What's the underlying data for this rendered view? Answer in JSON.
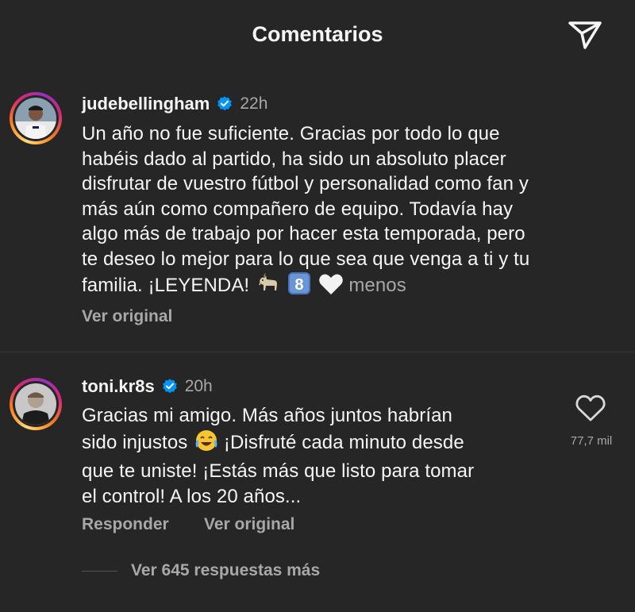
{
  "header": {
    "title": "Comentarios",
    "share_icon": "paper-plane-icon"
  },
  "comments": [
    {
      "username": "judebellingham",
      "verified": true,
      "time": "22h",
      "text": "Un año no fue suficiente. Gracias por todo lo que\nhabéis dado al partido, ha sido un absoluto placer\ndisfrutar de vuestro fútbol y personalidad como fan y\nmás aún como compañero de equipo. Todavía hay\nalgo más de trabajo por hacer esta temporada, pero\nte deseo lo mejor para lo que sea que venga a ti y tu\nfamilia. ¡LEYENDA! ",
      "emojis": [
        "goat-emoji",
        "keycap-8-emoji",
        "white-heart-emoji"
      ],
      "less_label": "menos",
      "see_translation": "Ver original"
    },
    {
      "username": "toni.kr8s",
      "verified": true,
      "time": "20h",
      "text_part1": "Gracias mi amigo. Más años juntos habrían\nsido injustos ",
      "emoji": "tears-of-joy-emoji",
      "text_part2": " ¡Disfruté cada minuto desde\nque te uniste! ¡Estás más que listo para tomar\nel control! A los 20 años...",
      "like_count": "77,7 mil",
      "reply_label": "Responder",
      "see_translation": "Ver original",
      "view_replies": "Ver 645 respuestas más"
    }
  ],
  "colors": {
    "background": "#262626",
    "text": "#f5f5f5",
    "secondary_text": "#a8a8a8",
    "verified_blue": "#0095f6"
  }
}
